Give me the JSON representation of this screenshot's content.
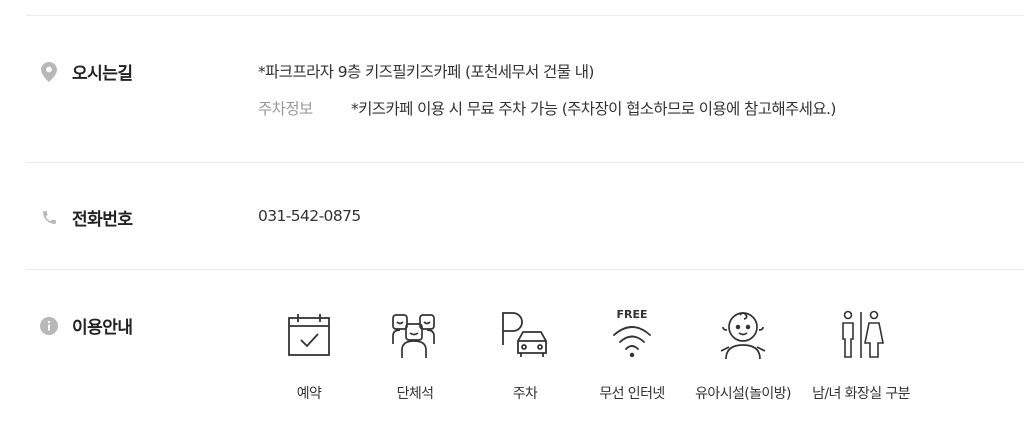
{
  "directions": {
    "label": "오시는길",
    "icon": "map-pin-icon",
    "address": "*파크프라자 9층 키즈필키즈카페 (포천세무서 건물 내)",
    "parking_label": "주차정보",
    "parking_text": "*키즈카페 이용 시 무료 주차 가능 (주차장이 협소하므로 이용에 참고해주세요.)"
  },
  "phone": {
    "label": "전화번호",
    "icon": "phone-icon",
    "number": "031-542-0875"
  },
  "usage": {
    "label": "이용안내",
    "icon": "info-icon",
    "amenities": [
      {
        "label": "예약",
        "icon": "calendar-check-icon"
      },
      {
        "label": "단체석",
        "icon": "group-icon"
      },
      {
        "label": "주차",
        "icon": "parking-icon"
      },
      {
        "label": "무선 인터넷",
        "icon": "wifi-icon",
        "badge": "FREE"
      },
      {
        "label": "유아시설(놀이방)",
        "icon": "baby-icon"
      },
      {
        "label": "남/녀 화장실 구분",
        "icon": "restroom-icon"
      }
    ]
  },
  "colors": {
    "icon_gray": "#b8b8b8",
    "line": "#ececec",
    "muted": "#999999"
  }
}
